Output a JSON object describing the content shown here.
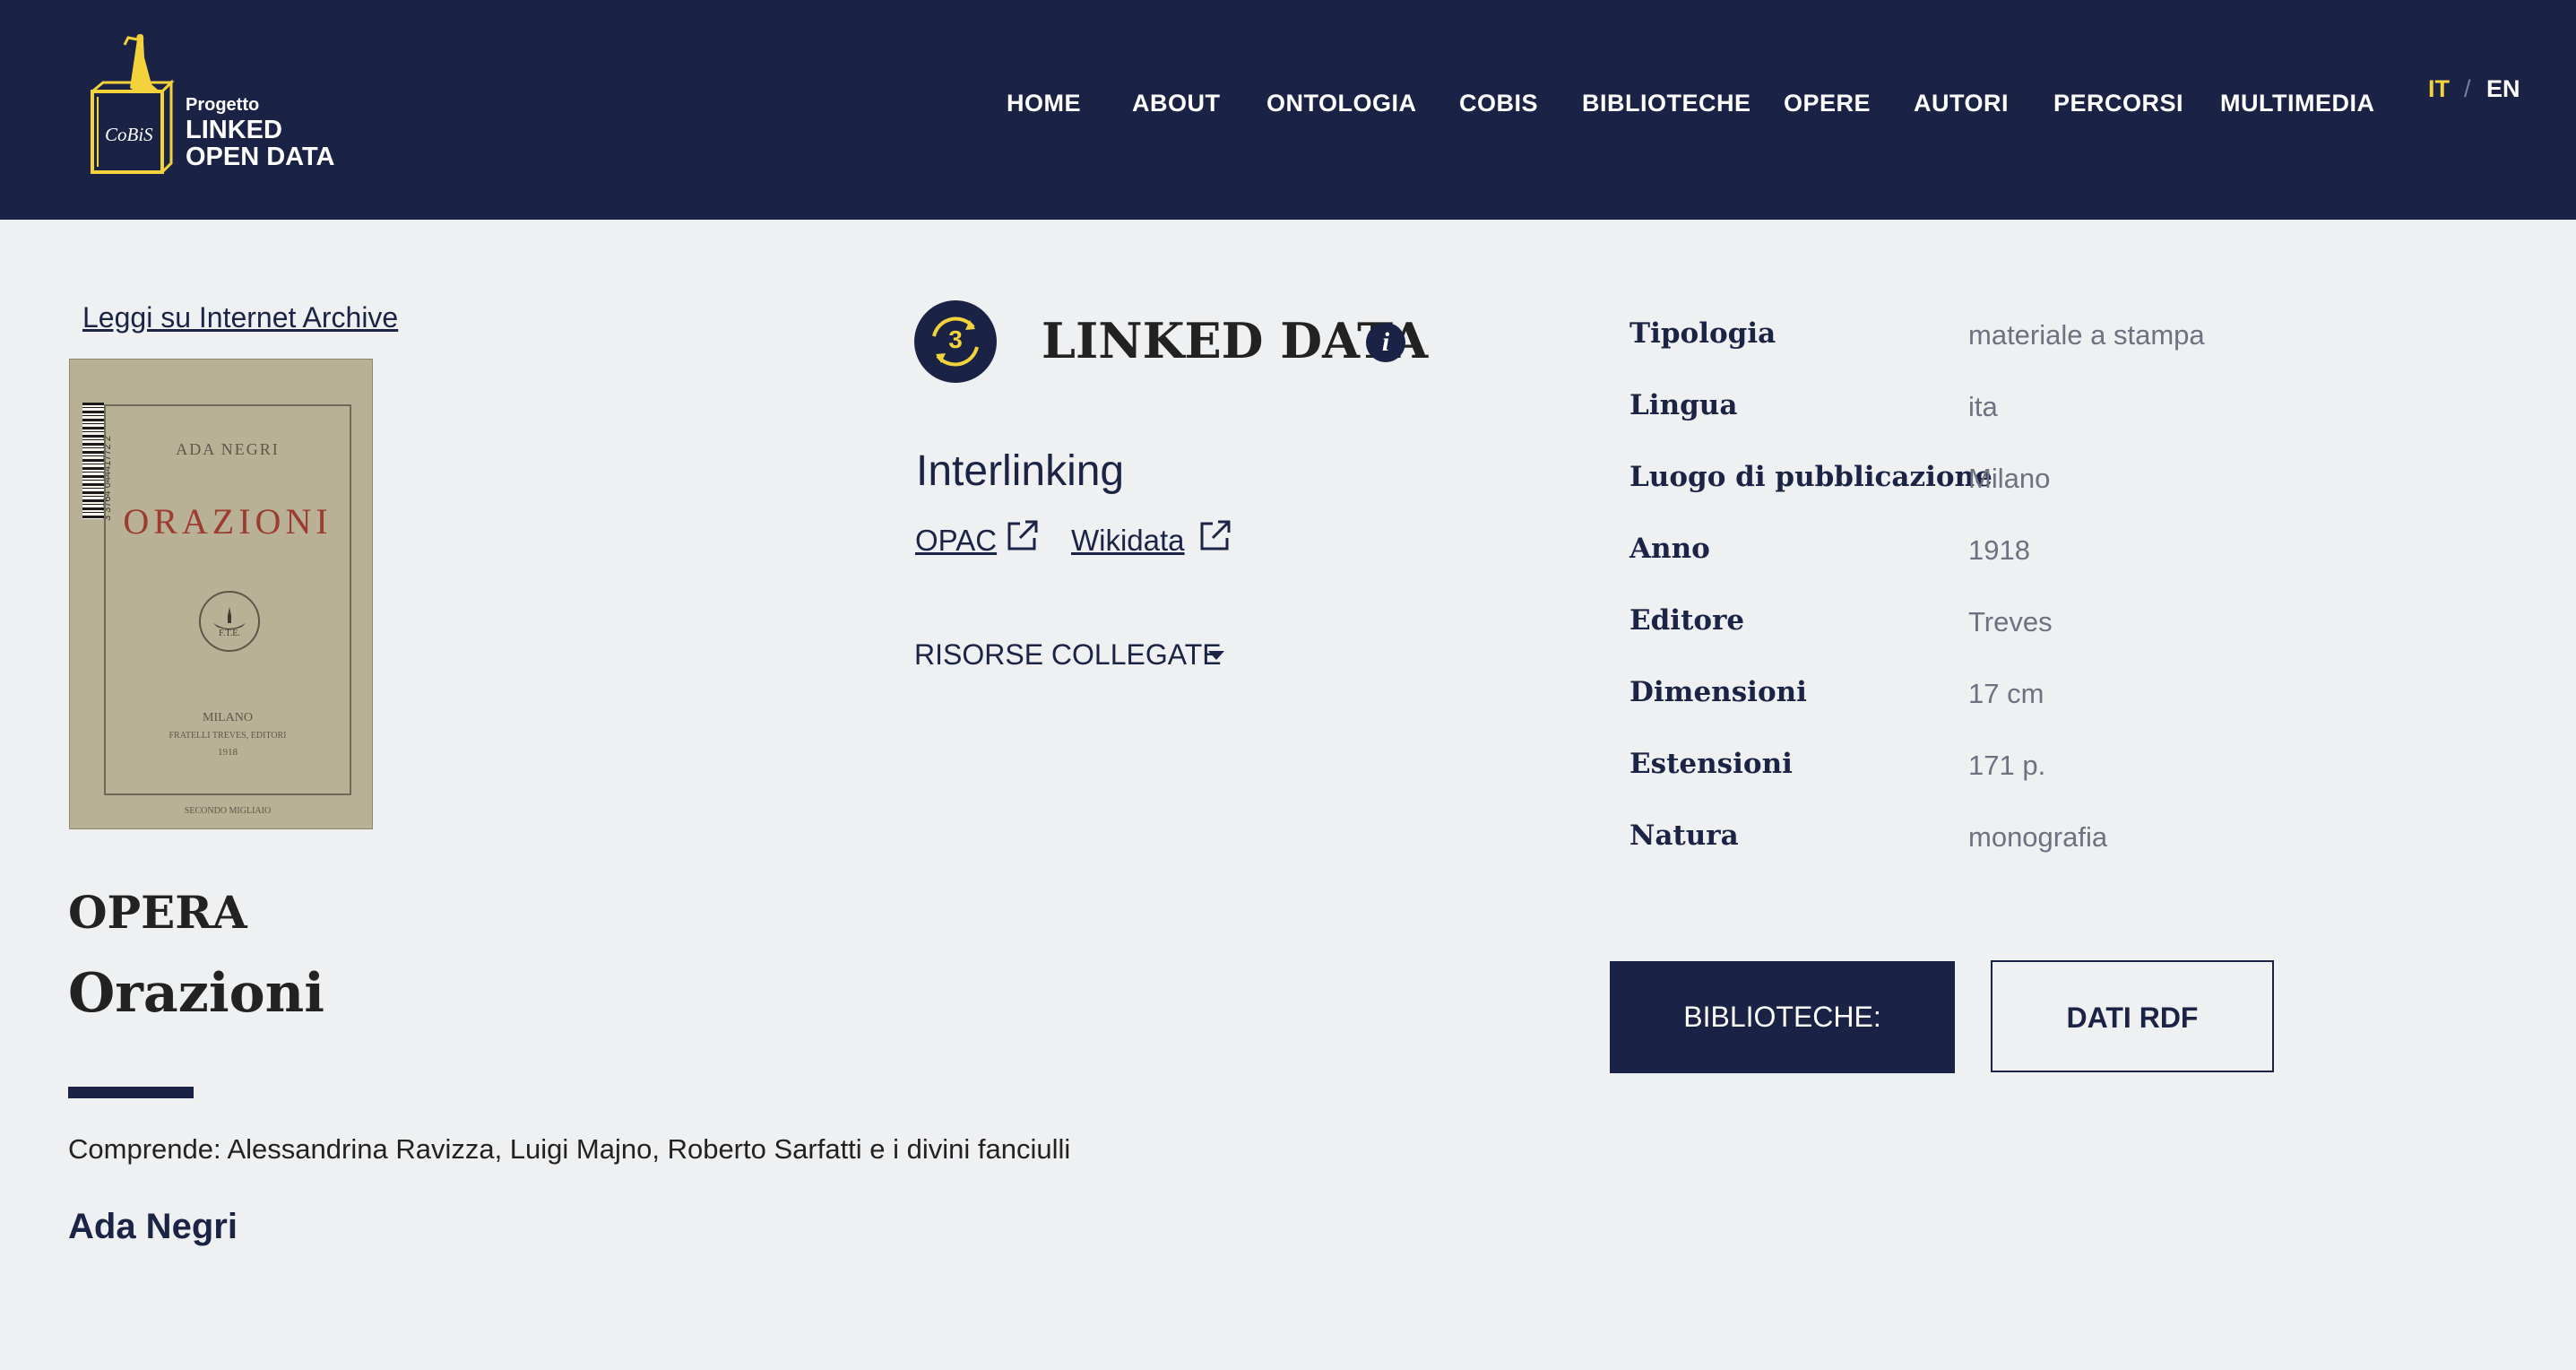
{
  "header": {
    "logo": {
      "small": "Progetto",
      "big_line1": "LINKED",
      "big_line2": "OPEN DATA",
      "book_text": "CoBiS"
    },
    "nav": [
      {
        "label": "HOME",
        "key": "home"
      },
      {
        "label": "ABOUT",
        "key": "about"
      },
      {
        "label": "ONTOLOGIA",
        "key": "ontologia"
      },
      {
        "label": "COBIS",
        "key": "cobis"
      },
      {
        "label": "BIBLIOTECHE",
        "key": "biblioteche"
      },
      {
        "label": "OPERE",
        "key": "opere"
      },
      {
        "label": "AUTORI",
        "key": "autori"
      },
      {
        "label": "PERCORSI",
        "key": "percorsi"
      },
      {
        "label": "MULTIMEDIA",
        "key": "multimedia"
      }
    ],
    "lang": {
      "it": "IT",
      "sep": "/",
      "en": "EN",
      "active": "IT"
    }
  },
  "left": {
    "ia_link": "Leggi su Internet Archive",
    "cover": {
      "author": "ADA NEGRI",
      "title": "ORAZIONI",
      "emblem": "F.T.E.",
      "city": "MILANO",
      "publisher": "FRATELLI TREVES, EDITORI",
      "year": "1918",
      "footer": "SECONDO MIGLIAIO",
      "barcode_number": "3 3764 04441772 2"
    },
    "opera_label": "OPERA",
    "opera_title": "Orazioni",
    "comprende": "Comprende: Alessandrina Ravizza, Luigi Majno, Roberto Sarfatti e i divini fanciulli",
    "author": "Ada Negri"
  },
  "middle": {
    "level": "3",
    "title": "LINKED DATA",
    "info_glyph": "i",
    "interlinking": "Interlinking",
    "links": [
      {
        "label": "OPAC"
      },
      {
        "label": "Wikidata"
      }
    ],
    "risorse": "RISORSE COLLEGATE"
  },
  "metadata": [
    {
      "key": "Tipologia",
      "value": "materiale a stampa"
    },
    {
      "key": "Lingua",
      "value": "ita"
    },
    {
      "key": "Luogo di pubblicazione",
      "value": "Milano"
    },
    {
      "key": "Anno",
      "value": "1918"
    },
    {
      "key": "Editore",
      "value": "Treves"
    },
    {
      "key": "Dimensioni",
      "value": "17 cm"
    },
    {
      "key": "Estensioni",
      "value": "171 p."
    },
    {
      "key": "Natura",
      "value": "monografia"
    }
  ],
  "buttons": {
    "biblioteche": "BIBLIOTECHE:",
    "rdf": "DATI RDF"
  },
  "colors": {
    "navy": "#1a2346",
    "accent_yellow": "#f2d33c",
    "background": "#eef0f2"
  }
}
